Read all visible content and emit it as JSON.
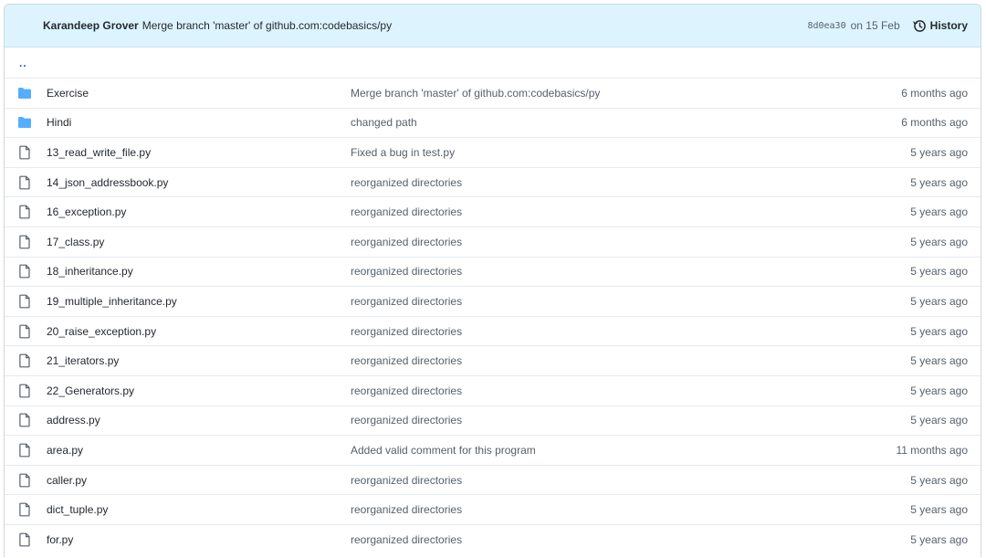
{
  "commit": {
    "author": "Karandeep Grover",
    "message": "Merge branch 'master' of github.com:codebasics/py",
    "sha": "8d0ea30",
    "date": "on 15 Feb",
    "history_label": "History"
  },
  "parent_dir": "..",
  "colors": {
    "header_bg": "#ddf4ff",
    "folder_icon": "#54aeff",
    "file_icon": "#57606a"
  },
  "files": [
    {
      "name": "Exercise",
      "type": "folder",
      "message": "Merge branch 'master' of github.com:codebasics/py",
      "age": "6 months ago"
    },
    {
      "name": "Hindi",
      "type": "folder",
      "message": "changed path",
      "age": "6 months ago"
    },
    {
      "name": "13_read_write_file.py",
      "type": "file",
      "message": "Fixed a bug in test.py",
      "age": "5 years ago"
    },
    {
      "name": "14_json_addressbook.py",
      "type": "file",
      "message": "reorganized directories",
      "age": "5 years ago"
    },
    {
      "name": "16_exception.py",
      "type": "file",
      "message": "reorganized directories",
      "age": "5 years ago"
    },
    {
      "name": "17_class.py",
      "type": "file",
      "message": "reorganized directories",
      "age": "5 years ago"
    },
    {
      "name": "18_inheritance.py",
      "type": "file",
      "message": "reorganized directories",
      "age": "5 years ago"
    },
    {
      "name": "19_multiple_inheritance.py",
      "type": "file",
      "message": "reorganized directories",
      "age": "5 years ago"
    },
    {
      "name": "20_raise_exception.py",
      "type": "file",
      "message": "reorganized directories",
      "age": "5 years ago"
    },
    {
      "name": "21_iterators.py",
      "type": "file",
      "message": "reorganized directories",
      "age": "5 years ago"
    },
    {
      "name": "22_Generators.py",
      "type": "file",
      "message": "reorganized directories",
      "age": "5 years ago"
    },
    {
      "name": "address.py",
      "type": "file",
      "message": "reorganized directories",
      "age": "5 years ago"
    },
    {
      "name": "area.py",
      "type": "file",
      "message": "Added valid comment for this program",
      "age": "11 months ago"
    },
    {
      "name": "caller.py",
      "type": "file",
      "message": "reorganized directories",
      "age": "5 years ago"
    },
    {
      "name": "dict_tuple.py",
      "type": "file",
      "message": "reorganized directories",
      "age": "5 years ago"
    },
    {
      "name": "for.py",
      "type": "file",
      "message": "reorganized directories",
      "age": "5 years ago"
    }
  ]
}
